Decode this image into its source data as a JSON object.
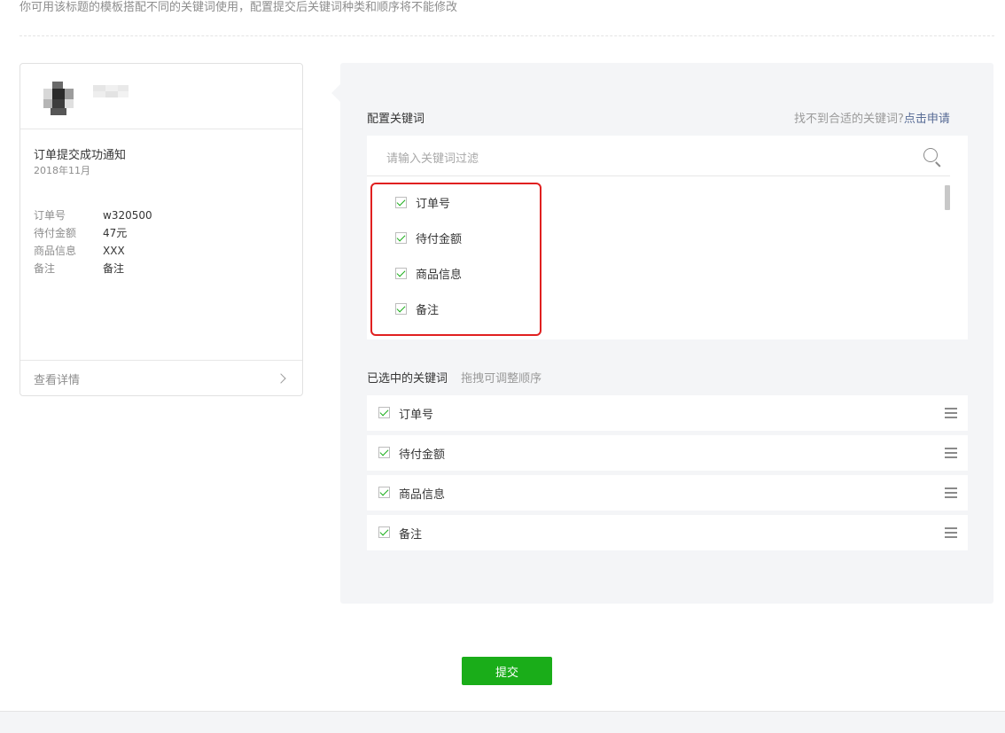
{
  "notice": "你可用该标题的模板搭配不同的关键词使用，配置提交后关键词种类和顺序将不能修改",
  "preview": {
    "title": "订单提交成功通知",
    "date": "2018年11月",
    "rows": [
      {
        "label": "订单号",
        "value": "w320500"
      },
      {
        "label": "待付金额",
        "value": "47元"
      },
      {
        "label": "商品信息",
        "value": "XXX"
      },
      {
        "label": "备注",
        "value": "备注"
      }
    ],
    "footer": "查看详情"
  },
  "config": {
    "title": "配置关键词",
    "hint": "找不到合适的关键词?",
    "apply_link": "点击申请",
    "filter_placeholder": "请输入关键词过滤",
    "options": [
      {
        "label": "订单号",
        "checked": true
      },
      {
        "label": "待付金额",
        "checked": true
      },
      {
        "label": "商品信息",
        "checked": true
      },
      {
        "label": "备注",
        "checked": true
      }
    ]
  },
  "selected": {
    "title": "已选中的关键词",
    "hint": "拖拽可调整顺序",
    "items": [
      {
        "label": "订单号",
        "checked": true
      },
      {
        "label": "待付金额",
        "checked": true
      },
      {
        "label": "商品信息",
        "checked": true
      },
      {
        "label": "备注",
        "checked": true
      }
    ]
  },
  "submit_label": "提交",
  "colors": {
    "primary_green": "#1aad19",
    "link_blue": "#576b95",
    "highlight_red": "#e02020",
    "panel_bg": "#f4f5f7"
  }
}
